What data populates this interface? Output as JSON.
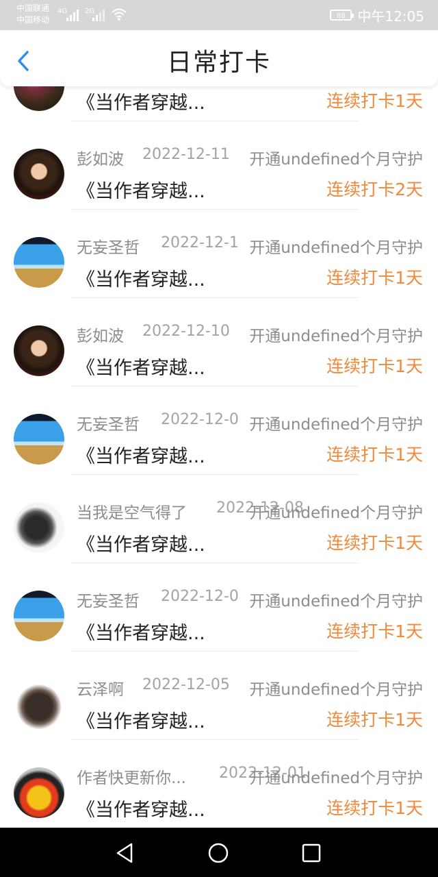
{
  "status_bar": {
    "carrier1": "中国联通",
    "carrier2": "中国移动",
    "signal1": "4G",
    "signal2": "2G",
    "battery": "88",
    "time": "中午12:05"
  },
  "header": {
    "title": "日常打卡"
  },
  "colors": {
    "accent": "#f0893a",
    "back": "#2b8ef0"
  },
  "rows": [
    {
      "name": "",
      "date": "",
      "message": "",
      "book": "《当作者穿越...",
      "streak": "连续打卡1天",
      "avatar": "flowers-avatar"
    },
    {
      "name": "彭如波",
      "date": "2022-12-11",
      "message": "开通undefined个月守护",
      "book": "《当作者穿越...",
      "streak": "连续打卡2天",
      "avatar": "portrait-avatar"
    },
    {
      "name": "无妄圣哲",
      "date": "2022-12-1",
      "message": "开通undefined个月守护",
      "book": "《当作者穿越...",
      "streak": "连续打卡1天",
      "avatar": "beach-avatar"
    },
    {
      "name": "彭如波",
      "date": "2022-12-10",
      "message": "开通undefined个月守护",
      "book": "《当作者穿越...",
      "streak": "连续打卡1天",
      "avatar": "portrait-avatar"
    },
    {
      "name": "无妄圣哲",
      "date": "2022-12-0",
      "message": "开通undefined个月守护",
      "book": "《当作者穿越...",
      "streak": "连续打卡1天",
      "avatar": "beach-avatar"
    },
    {
      "name": "当我是空气得了",
      "date": "2022-12-08",
      "message": "开通undefined个月守护",
      "book": "《当作者穿越...",
      "streak": "连续打卡1天",
      "avatar": "cat-avatar"
    },
    {
      "name": "无妄圣哲",
      "date": "2022-12-0",
      "message": "开通undefined个月守护",
      "book": "《当作者穿越...",
      "streak": "连续打卡1天",
      "avatar": "beach-avatar"
    },
    {
      "name": "云泽啊",
      "date": "2022-12-05",
      "message": "开通undefined个月守护",
      "book": "《当作者穿越...",
      "streak": "连续打卡1天",
      "avatar": "wolf-avatar"
    },
    {
      "name": "作者快更新你...",
      "date": "2022-12-01",
      "message": "开通undefined个月守护",
      "book": "《当作者穿越...",
      "streak": "连续打卡1天",
      "avatar": "duck-avatar"
    }
  ]
}
